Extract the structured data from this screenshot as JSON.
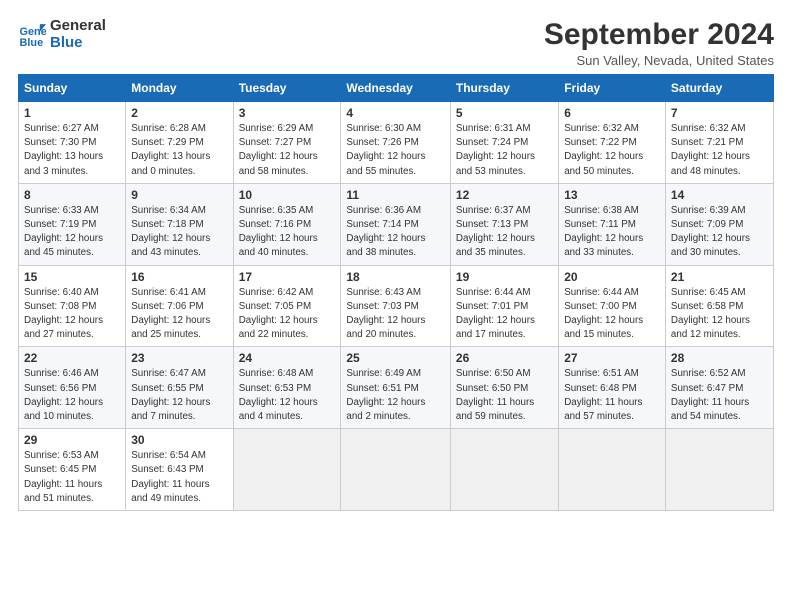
{
  "logo": {
    "line1": "General",
    "line2": "Blue"
  },
  "title": "September 2024",
  "subtitle": "Sun Valley, Nevada, United States",
  "headers": [
    "Sunday",
    "Monday",
    "Tuesday",
    "Wednesday",
    "Thursday",
    "Friday",
    "Saturday"
  ],
  "weeks": [
    [
      {
        "day": "1",
        "info": "Sunrise: 6:27 AM\nSunset: 7:30 PM\nDaylight: 13 hours\nand 3 minutes."
      },
      {
        "day": "2",
        "info": "Sunrise: 6:28 AM\nSunset: 7:29 PM\nDaylight: 13 hours\nand 0 minutes."
      },
      {
        "day": "3",
        "info": "Sunrise: 6:29 AM\nSunset: 7:27 PM\nDaylight: 12 hours\nand 58 minutes."
      },
      {
        "day": "4",
        "info": "Sunrise: 6:30 AM\nSunset: 7:26 PM\nDaylight: 12 hours\nand 55 minutes."
      },
      {
        "day": "5",
        "info": "Sunrise: 6:31 AM\nSunset: 7:24 PM\nDaylight: 12 hours\nand 53 minutes."
      },
      {
        "day": "6",
        "info": "Sunrise: 6:32 AM\nSunset: 7:22 PM\nDaylight: 12 hours\nand 50 minutes."
      },
      {
        "day": "7",
        "info": "Sunrise: 6:32 AM\nSunset: 7:21 PM\nDaylight: 12 hours\nand 48 minutes."
      }
    ],
    [
      {
        "day": "8",
        "info": "Sunrise: 6:33 AM\nSunset: 7:19 PM\nDaylight: 12 hours\nand 45 minutes."
      },
      {
        "day": "9",
        "info": "Sunrise: 6:34 AM\nSunset: 7:18 PM\nDaylight: 12 hours\nand 43 minutes."
      },
      {
        "day": "10",
        "info": "Sunrise: 6:35 AM\nSunset: 7:16 PM\nDaylight: 12 hours\nand 40 minutes."
      },
      {
        "day": "11",
        "info": "Sunrise: 6:36 AM\nSunset: 7:14 PM\nDaylight: 12 hours\nand 38 minutes."
      },
      {
        "day": "12",
        "info": "Sunrise: 6:37 AM\nSunset: 7:13 PM\nDaylight: 12 hours\nand 35 minutes."
      },
      {
        "day": "13",
        "info": "Sunrise: 6:38 AM\nSunset: 7:11 PM\nDaylight: 12 hours\nand 33 minutes."
      },
      {
        "day": "14",
        "info": "Sunrise: 6:39 AM\nSunset: 7:09 PM\nDaylight: 12 hours\nand 30 minutes."
      }
    ],
    [
      {
        "day": "15",
        "info": "Sunrise: 6:40 AM\nSunset: 7:08 PM\nDaylight: 12 hours\nand 27 minutes."
      },
      {
        "day": "16",
        "info": "Sunrise: 6:41 AM\nSunset: 7:06 PM\nDaylight: 12 hours\nand 25 minutes."
      },
      {
        "day": "17",
        "info": "Sunrise: 6:42 AM\nSunset: 7:05 PM\nDaylight: 12 hours\nand 22 minutes."
      },
      {
        "day": "18",
        "info": "Sunrise: 6:43 AM\nSunset: 7:03 PM\nDaylight: 12 hours\nand 20 minutes."
      },
      {
        "day": "19",
        "info": "Sunrise: 6:44 AM\nSunset: 7:01 PM\nDaylight: 12 hours\nand 17 minutes."
      },
      {
        "day": "20",
        "info": "Sunrise: 6:44 AM\nSunset: 7:00 PM\nDaylight: 12 hours\nand 15 minutes."
      },
      {
        "day": "21",
        "info": "Sunrise: 6:45 AM\nSunset: 6:58 PM\nDaylight: 12 hours\nand 12 minutes."
      }
    ],
    [
      {
        "day": "22",
        "info": "Sunrise: 6:46 AM\nSunset: 6:56 PM\nDaylight: 12 hours\nand 10 minutes."
      },
      {
        "day": "23",
        "info": "Sunrise: 6:47 AM\nSunset: 6:55 PM\nDaylight: 12 hours\nand 7 minutes."
      },
      {
        "day": "24",
        "info": "Sunrise: 6:48 AM\nSunset: 6:53 PM\nDaylight: 12 hours\nand 4 minutes."
      },
      {
        "day": "25",
        "info": "Sunrise: 6:49 AM\nSunset: 6:51 PM\nDaylight: 12 hours\nand 2 minutes."
      },
      {
        "day": "26",
        "info": "Sunrise: 6:50 AM\nSunset: 6:50 PM\nDaylight: 11 hours\nand 59 minutes."
      },
      {
        "day": "27",
        "info": "Sunrise: 6:51 AM\nSunset: 6:48 PM\nDaylight: 11 hours\nand 57 minutes."
      },
      {
        "day": "28",
        "info": "Sunrise: 6:52 AM\nSunset: 6:47 PM\nDaylight: 11 hours\nand 54 minutes."
      }
    ],
    [
      {
        "day": "29",
        "info": "Sunrise: 6:53 AM\nSunset: 6:45 PM\nDaylight: 11 hours\nand 51 minutes."
      },
      {
        "day": "30",
        "info": "Sunrise: 6:54 AM\nSunset: 6:43 PM\nDaylight: 11 hours\nand 49 minutes."
      },
      null,
      null,
      null,
      null,
      null
    ]
  ]
}
